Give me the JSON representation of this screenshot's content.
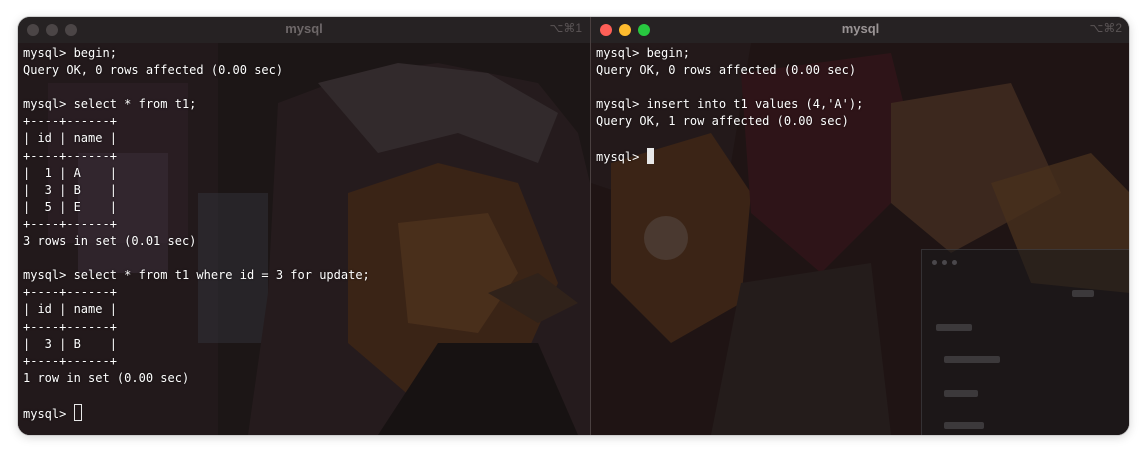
{
  "left_pane": {
    "title": "mysql",
    "shortcut": "⌥⌘1",
    "lines": [
      "mysql> begin;",
      "Query OK, 0 rows affected (0.00 sec)",
      "",
      "mysql> select * from t1;",
      "+----+------+",
      "| id | name |",
      "+----+------+",
      "|  1 | A    |",
      "|  3 | B    |",
      "|  5 | E    |",
      "+----+------+",
      "3 rows in set (0.01 sec)",
      "",
      "mysql> select * from t1 where id = 3 for update;",
      "+----+------+",
      "| id | name |",
      "+----+------+",
      "|  3 | B    |",
      "+----+------+",
      "1 row in set (0.00 sec)",
      ""
    ],
    "prompt": "mysql> "
  },
  "right_pane": {
    "title": "mysql",
    "shortcut": "⌥⌘2",
    "lines": [
      "mysql> begin;",
      "Query OK, 0 rows affected (0.00 sec)",
      "",
      "mysql> insert into t1 values (4,'A');",
      "Query OK, 1 row affected (0.00 sec)",
      ""
    ],
    "prompt": "mysql> "
  },
  "colors": {
    "close": "#fe5f57",
    "minimize": "#febc2e",
    "zoom": "#28c840",
    "terminal_text": "#ffffff"
  }
}
